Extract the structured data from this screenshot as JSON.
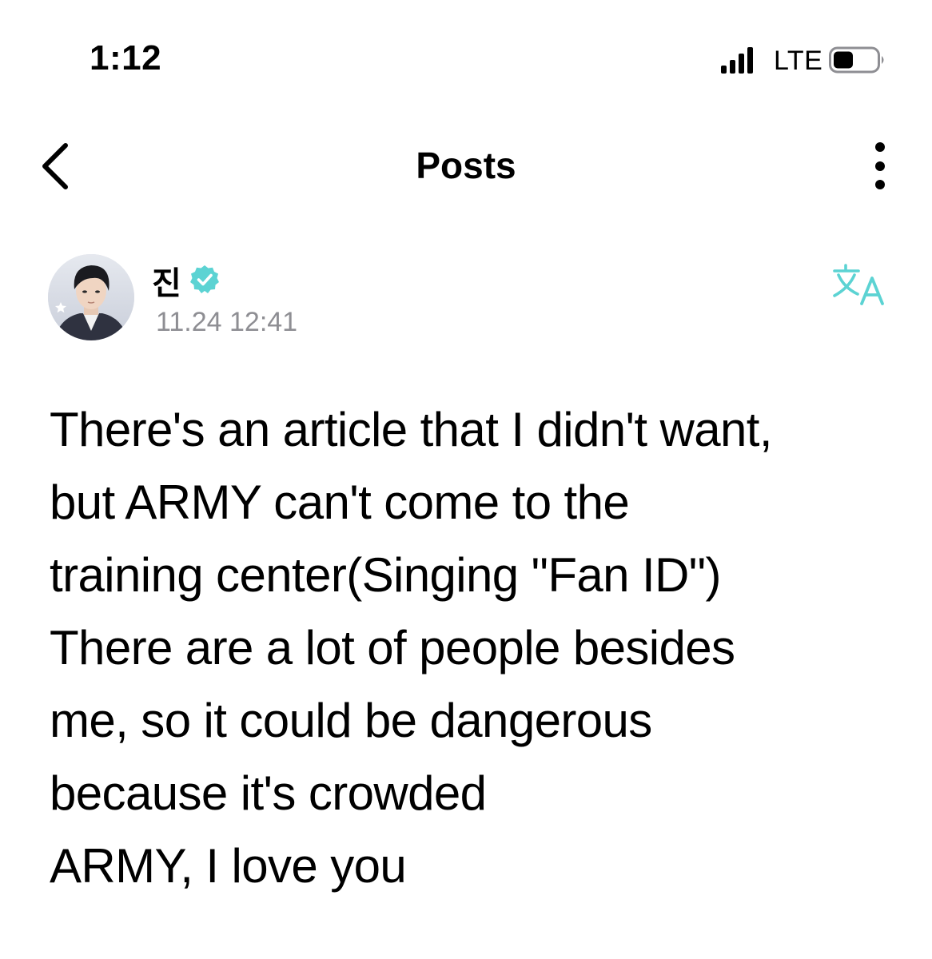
{
  "status_bar": {
    "time": "1:12",
    "network": "LTE",
    "signal_icon": "signal-bars-icon",
    "battery_icon": "battery-icon"
  },
  "header": {
    "title": "Posts",
    "back_icon": "chevron-left-icon",
    "more_icon": "more-vertical-icon"
  },
  "post": {
    "author": "진",
    "verified_icon": "verified-badge-icon",
    "timestamp": "11.24 12:41",
    "translate_icon": "translate-icon",
    "lines": [
      "There's an article that I didn't want,",
      "but ARMY can't come to the",
      "training center(Singing \"Fan ID\")",
      "There are a lot of people besides",
      "me, so it could be dangerous",
      "because it's crowded",
      "ARMY, I love you"
    ]
  },
  "colors": {
    "accent": "#5cd3d3",
    "muted_text": "#8e8e93",
    "text": "#000000"
  }
}
